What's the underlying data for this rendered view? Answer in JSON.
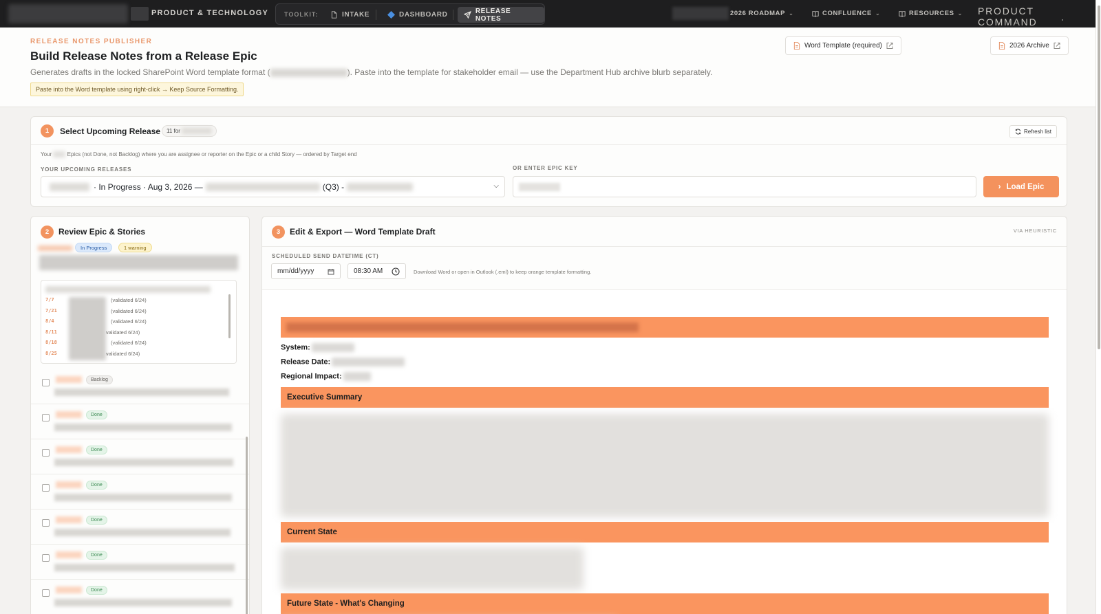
{
  "nav": {
    "brand": "PRODUCT & TECHNOLOGY",
    "toolkit_label": "TOOLKIT:",
    "tabs": [
      {
        "label": "INTAKE",
        "icon": "file-icon"
      },
      {
        "label": "DASHBOARD",
        "icon": "diamond-icon"
      },
      {
        "label": "RELEASE NOTES",
        "icon": "send-icon"
      }
    ],
    "roadmap": "2026 ROADMAP",
    "confluence": "CONFLUENCE",
    "resources": "RESOURCES",
    "command": "PRODUCT COMMAND"
  },
  "header": {
    "eyebrow": "RELEASE NOTES PUBLISHER",
    "title": "Build Release Notes from a Release Epic",
    "subtitle_before": "Generates drafts in the locked SharePoint Word template format (",
    "subtitle_after": "). Paste into the template for stakeholder email — use the Department Hub archive blurb separately.",
    "notice": "Paste into the Word template using right-click → Keep Source Formatting.",
    "word_template_button": "Word Template (required)",
    "archive_button": "2026 Archive"
  },
  "step1": {
    "number": "1",
    "title": "Select Upcoming Release",
    "count": "11 for",
    "refresh": "Refresh list",
    "help_before": "Your",
    "help_after": "Epics (not Done, not Backlog) where you are assignee or reporter on the Epic or a child Story — ordered by Target end",
    "upcoming_label": "YOUR UPCOMING RELEASES",
    "select_status": "· In Progress · Aug 3, 2026 —",
    "select_quarter": "(Q3) -",
    "epic_key_label": "OR ENTER EPIC KEY",
    "load_button": "Load Epic"
  },
  "step2": {
    "number": "2",
    "title": "Review Epic & Stories",
    "status_badge": "In Progress",
    "warning_badge": "1 warning",
    "timeline": [
      {
        "date": "7/7",
        "note": "(validated 6/24)"
      },
      {
        "date": "7/21",
        "note": "(validated 6/24)"
      },
      {
        "date": "8/4",
        "note": "(validated 6/24)"
      },
      {
        "date": "8/11",
        "note": "validated 6/24)"
      },
      {
        "date": "8/18",
        "note": "(validated 6/24)"
      },
      {
        "date": "8/25",
        "note": "validated 6/24)"
      }
    ],
    "stories": [
      {
        "status": "Backlog"
      },
      {
        "status": "Done"
      },
      {
        "status": "Done"
      },
      {
        "status": "Done"
      },
      {
        "status": "Done"
      },
      {
        "status": "Done"
      },
      {
        "status": "Done"
      }
    ]
  },
  "step3": {
    "number": "3",
    "title": "Edit & Export — Word Template Draft",
    "via": "VIA HEURISTIC",
    "send_date_label": "SCHEDULED SEND DATE",
    "send_date_placeholder": "mm/dd/yyyy",
    "time_label": "TIME (CT)",
    "time_value": "08:30 AM",
    "download_help": "Download Word or open in Outlook (.eml) to keep orange template formatting.",
    "doc": {
      "system_label": "System:",
      "release_date_label": "Release Date:",
      "regional_impact_label": "Regional Impact:",
      "sections": [
        "Executive Summary",
        "Current State",
        "Future State - What's Changing"
      ]
    }
  },
  "colors": {
    "accent": "#f4925d",
    "band": "#fa955f",
    "nav_bg": "#1e1e1f"
  }
}
